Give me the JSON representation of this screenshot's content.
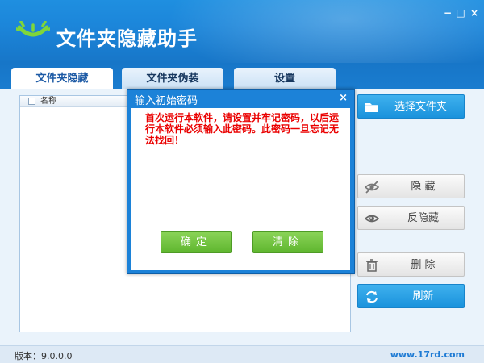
{
  "app": {
    "title": "文件夹隐藏助手",
    "window_controls": [
      "−",
      "□",
      "×"
    ]
  },
  "tabs": [
    {
      "label": "文件夹隐藏",
      "active": true
    },
    {
      "label": "文件夹伪装",
      "active": false
    },
    {
      "label": "设置",
      "active": false
    }
  ],
  "list": {
    "column_header": "名称"
  },
  "side_buttons": {
    "select_folder": "选择文件夹",
    "hide": "隐 藏",
    "unhide": "反隐藏",
    "delete": "删 除",
    "refresh": "刷新"
  },
  "status": {
    "version": "版本：9.0.0.0",
    "site": "www.17rd.com"
  },
  "dialog": {
    "title": "输入初始密码",
    "close": "×",
    "message": "首次运行本软件，请设置并牢记密码，以后运行本软件必须输入此密码。此密码一旦忘记无法找回！",
    "ok_label": "确定",
    "clear_label": "清除"
  },
  "colors": {
    "header_blue": "#1c86da",
    "accent_blue": "#1a92dc",
    "green_button": "#5fb62f",
    "warning_red": "#ea0000"
  }
}
